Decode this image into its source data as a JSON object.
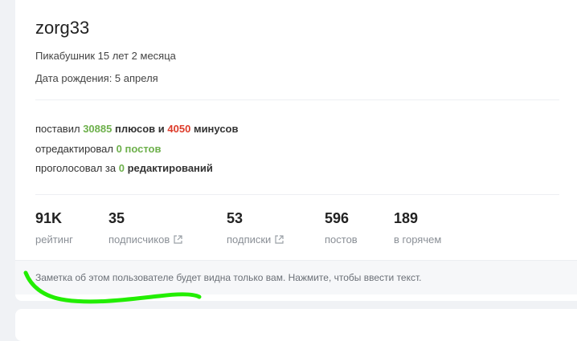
{
  "profile": {
    "username": "zorg33",
    "tenure": "Пикабушник 15 лет 2 месяца",
    "birthday": "Дата рождения: 5 апреля"
  },
  "activity": {
    "line1": {
      "prefix": "поставил",
      "plus_count": "30885",
      "plus_label": "плюсов и",
      "minus_count": "4050",
      "minus_label": "минусов"
    },
    "line2": {
      "prefix": "отредактировал",
      "count": "0",
      "label": "постов"
    },
    "line3": {
      "prefix": "проголосовал за",
      "count": "0",
      "label": "редактирований"
    }
  },
  "stats": [
    {
      "value": "91K",
      "label": "рейтинг"
    },
    {
      "value": "35",
      "label": "подписчиков"
    },
    {
      "value": "53",
      "label": "подписки"
    },
    {
      "value": "596",
      "label": "постов"
    },
    {
      "value": "189",
      "label": "в горячем"
    }
  ],
  "note": {
    "text": "Заметка об этом пользователе будет видна только вам. Нажмите, чтобы ввести текст."
  },
  "colors": {
    "accent_green": "#6db04b",
    "minus_red": "#dd3b2a",
    "button_green": "#86c25a",
    "scribble_green": "#22ee00"
  }
}
